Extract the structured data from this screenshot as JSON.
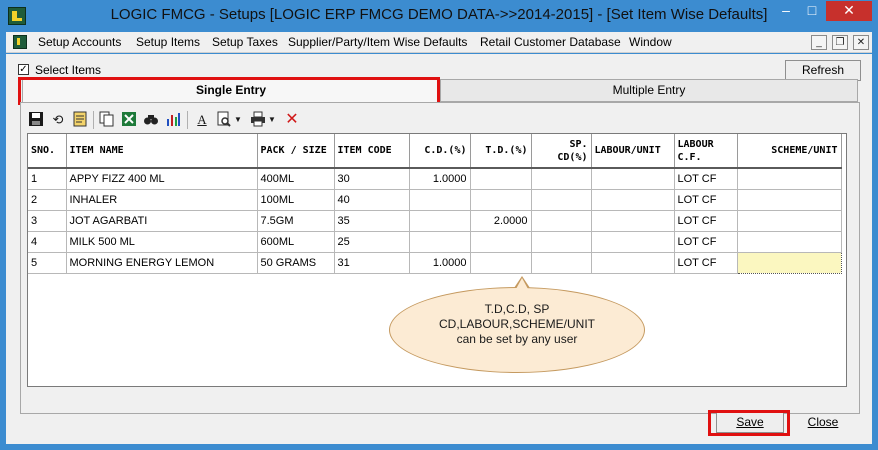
{
  "window": {
    "title": "LOGIC FMCG - Setups  [LOGIC ERP FMCG DEMO DATA->>2014-2015] - [Set Item Wise Defaults]",
    "min_glyph": "–",
    "max_glyph": "□",
    "close_glyph": "✕"
  },
  "menu": {
    "items": [
      "Setup Accounts",
      "Setup Items",
      "Setup Taxes",
      "Supplier/Party/Item Wise Defaults",
      "Retail Customer Database",
      "Window"
    ],
    "mdi_min": "_",
    "mdi_restore": "❐",
    "mdi_close": "✕"
  },
  "options": {
    "select_items_label": "Select Items",
    "select_items_checked": true,
    "check_glyph": "✓",
    "refresh_label": "Refresh"
  },
  "tabs": {
    "single": "Single Entry",
    "multiple": "Multiple Entry"
  },
  "toolbar": {
    "icons": [
      "save-icon",
      "undo-icon",
      "notes-icon",
      "copy-icon",
      "excel-icon",
      "find-icon",
      "chart-icon",
      "font-icon",
      "print-preview-icon",
      "dropdown-icon",
      "print-icon",
      "dropdown-icon",
      "delete-icon"
    ]
  },
  "grid": {
    "headers": [
      "SNO.",
      "ITEM NAME",
      "PACK / SIZE",
      "ITEM CODE",
      "C.D.(%)",
      "T.D.(%)",
      "SP. CD(%)",
      "LABOUR/UNIT",
      "LABOUR C.F.",
      "SCHEME/UNIT"
    ],
    "rows": [
      [
        "1",
        "APPY FIZZ 400 ML",
        "400ML",
        "30",
        "1.0000",
        "",
        "",
        "",
        "LOT CF",
        ""
      ],
      [
        "2",
        "INHALER",
        "100ML",
        "40",
        "",
        "",
        "",
        "",
        "LOT CF",
        ""
      ],
      [
        "3",
        "JOT AGARBATI",
        "7.5GM",
        "35",
        "",
        "2.0000",
        "",
        "",
        "LOT CF",
        ""
      ],
      [
        "4",
        "MILK 500 ML",
        "600ML",
        "25",
        "",
        "",
        "",
        "",
        "LOT CF",
        ""
      ],
      [
        "5",
        "MORNING ENERGY LEMON",
        "50 GRAMS",
        "31",
        "1.0000",
        "",
        "",
        "",
        "LOT CF",
        ""
      ]
    ]
  },
  "callout": {
    "line1": "T.D,C.D, SP",
    "line2": "CD,LABOUR,SCHEME/UNIT",
    "line3": "can be set by any user"
  },
  "buttons": {
    "save": "Save",
    "close": "Close"
  },
  "colors": {
    "titlebar": "#3c8cd0",
    "highlight_red": "#e01010",
    "selected_cell": "#fbf7c0",
    "callout_fill": "#fcebd4"
  }
}
